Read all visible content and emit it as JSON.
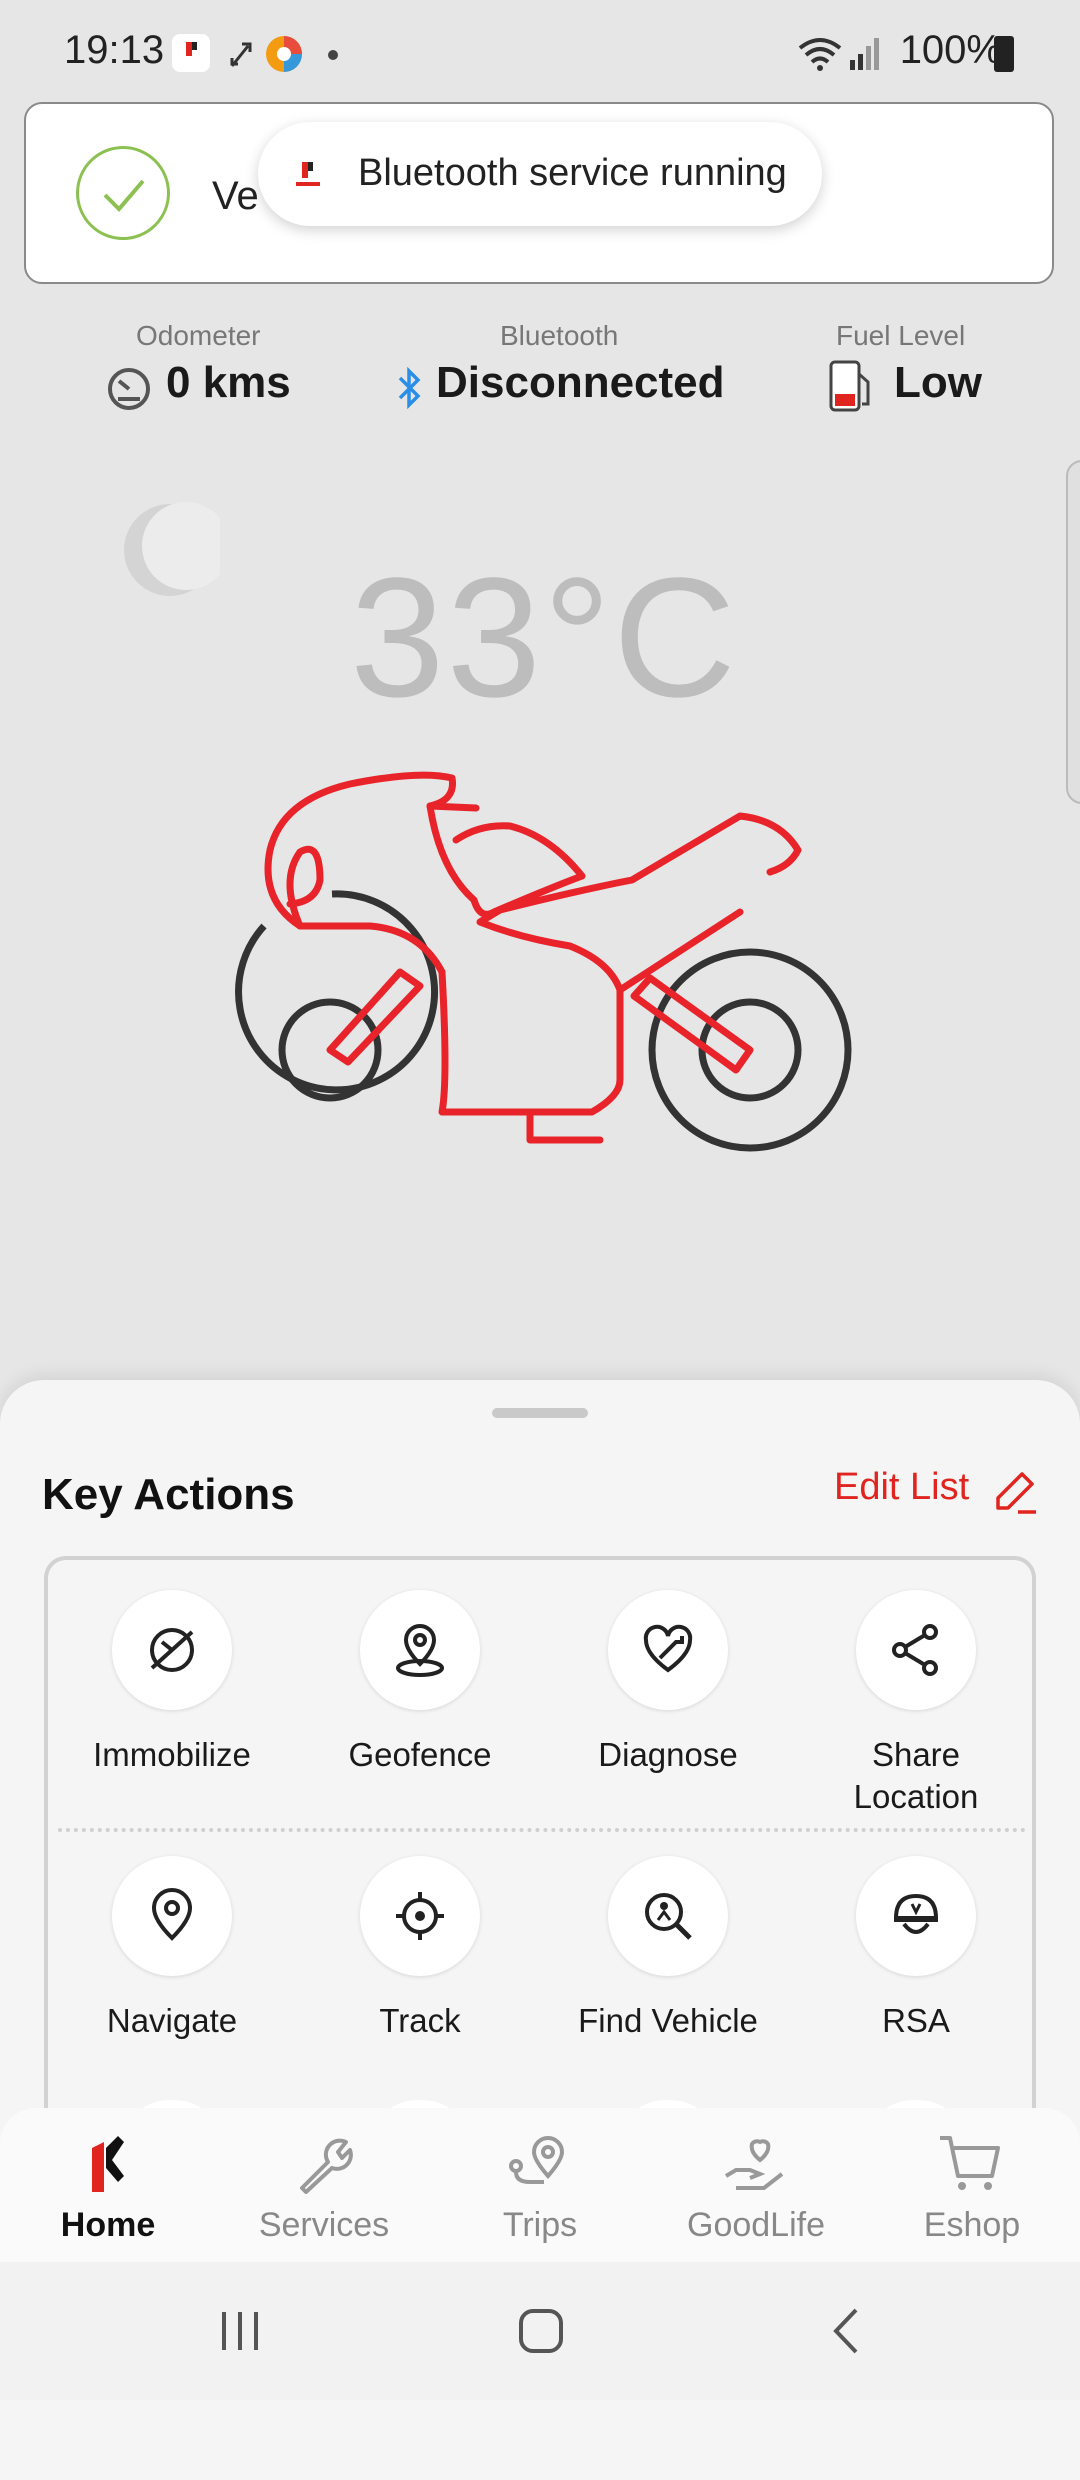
{
  "status_bar": {
    "time": "19:13",
    "battery": "100%"
  },
  "notification": {
    "text_fragment": "Ve",
    "toast_message": "Bluetooth service running"
  },
  "stats": {
    "odometer": {
      "label": "Odometer",
      "value": "0 kms"
    },
    "bluetooth": {
      "label": "Bluetooth",
      "value": "Disconnected"
    },
    "fuel": {
      "label": "Fuel Level",
      "value": "Low"
    }
  },
  "weather": {
    "temperature": "33°C",
    "icon": "moon-icon"
  },
  "sheet": {
    "title": "Key Actions",
    "edit_label": "Edit List",
    "actions": [
      {
        "label": "Immobilize",
        "icon": "immobilize-icon"
      },
      {
        "label": "Geofence",
        "icon": "geofence-icon"
      },
      {
        "label": "Diagnose",
        "icon": "diagnose-icon"
      },
      {
        "label": "Share\nLocation",
        "icon": "share-icon"
      },
      {
        "label": "Navigate",
        "icon": "navigate-icon"
      },
      {
        "label": "Track",
        "icon": "track-icon"
      },
      {
        "label": "Find Vehicle",
        "icon": "find-vehicle-icon"
      },
      {
        "label": "RSA",
        "icon": "rsa-icon"
      }
    ]
  },
  "nav": {
    "items": [
      {
        "label": "Home",
        "icon": "home-icon",
        "active": true
      },
      {
        "label": "Services",
        "icon": "wrench-icon"
      },
      {
        "label": "Trips",
        "icon": "trips-icon"
      },
      {
        "label": "GoodLife",
        "icon": "goodlife-icon"
      },
      {
        "label": "Eshop",
        "icon": "cart-icon"
      }
    ]
  },
  "colors": {
    "accent": "#e0241f",
    "bike_red": "#e8242a",
    "bluetooth_blue": "#2a8ee8",
    "check_green": "#8cc152"
  }
}
